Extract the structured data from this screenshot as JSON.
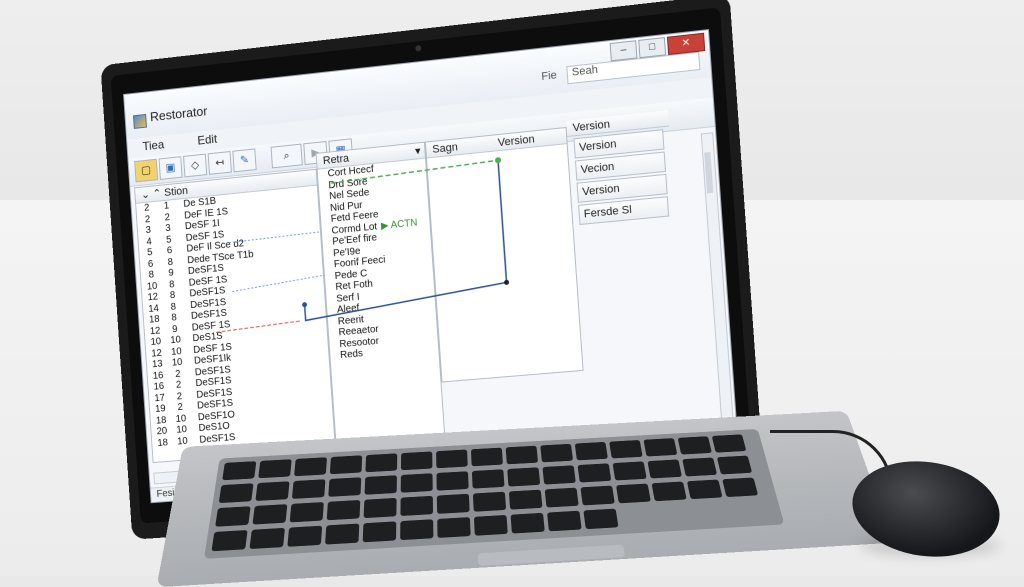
{
  "window": {
    "title": "Restorator",
    "search_label": "Fie",
    "search_placeholder": "Seah"
  },
  "menu": [
    "Tiea",
    "Edit"
  ],
  "toolbar": {
    "group1_icons": [
      "folder-icon",
      "save-icon",
      "back-icon",
      "forward-icon",
      "edit-icon"
    ],
    "group2_icons": [
      "search-icon",
      "play-icon",
      "resource-icon"
    ]
  },
  "columns": {
    "left_header": "Stion",
    "middle_header": "Retra",
    "right_header1": "Sagn",
    "right_header2": "Version",
    "far_right_header": "Version"
  },
  "left_rows": [
    {
      "a": "2",
      "b": "1",
      "label": "De S1B"
    },
    {
      "a": "2",
      "b": "2",
      "label": "DeF IE 1S"
    },
    {
      "a": "3",
      "b": "3",
      "label": "DeSF 1I"
    },
    {
      "a": "4",
      "b": "5",
      "label": "DeSF 1S"
    },
    {
      "a": "5",
      "b": "6",
      "label": "DeF Il Sce d2"
    },
    {
      "a": "6",
      "b": "8",
      "label": "Dede TSce T1b"
    },
    {
      "a": "8",
      "b": "9",
      "label": "DeSF1S"
    },
    {
      "a": "10",
      "b": "8",
      "label": "DeSF 1S"
    },
    {
      "a": "12",
      "b": "8",
      "label": "DeSF1S"
    },
    {
      "a": "14",
      "b": "8",
      "label": "DeSF1S"
    },
    {
      "a": "18",
      "b": "8",
      "label": "DeSF1S"
    },
    {
      "a": "12",
      "b": "9",
      "label": "DeSF 1S"
    },
    {
      "a": "10",
      "b": "10",
      "label": "DeS1S"
    },
    {
      "a": "12",
      "b": "10",
      "label": "DeSF 1S"
    },
    {
      "a": "13",
      "b": "10",
      "label": "DeSF1Ik"
    },
    {
      "a": "16",
      "b": "2",
      "label": "DeSF1S"
    },
    {
      "a": "16",
      "b": "2",
      "label": "DeSF1S"
    },
    {
      "a": "17",
      "b": "2",
      "label": "DeSF1S"
    },
    {
      "a": "19",
      "b": "2",
      "label": "DeSF1S"
    },
    {
      "a": "18",
      "b": "10",
      "label": "DeSF1O"
    },
    {
      "a": "20",
      "b": "10",
      "label": "DeS1O"
    },
    {
      "a": "18",
      "b": "10",
      "label": "DeSF1S"
    }
  ],
  "resource_rows": [
    "Cort Hcecf",
    "Drd Sore",
    "Nel Sede",
    "Nid Pur",
    "Fetd Feere",
    "Cormd Lot",
    "Pe'Eef fire",
    "Pe'I9e",
    "Foorif Feeci",
    "Pede C",
    "Ret Foth",
    "Serf I",
    "Aleef",
    "Reerit",
    "Reeaetor",
    "Resootor",
    "Reds"
  ],
  "annotation": "▶ ACTN",
  "side_buttons": [
    "Version",
    "Vecion",
    "Version",
    "Fersde Sl"
  ],
  "status": "Fesio"
}
